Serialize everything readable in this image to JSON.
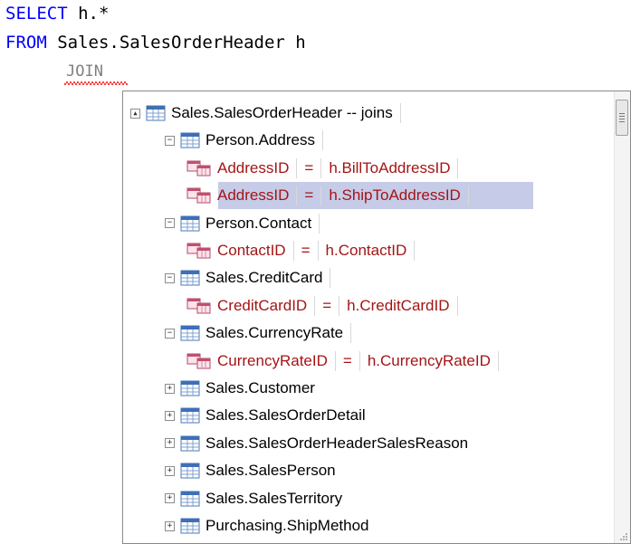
{
  "editor": {
    "line1": {
      "keyword": "SELECT",
      "rest": " h.*"
    },
    "line2": {
      "keyword": "FROM",
      "rest": " Sales.SalesOrderHeader h"
    },
    "line3": {
      "text": "JOIN"
    }
  },
  "popup": {
    "root": "Sales.SalesOrderHeader -- joins",
    "items": [
      {
        "table": "Person.Address",
        "expanded": true
      },
      {
        "left": "AddressID",
        "op": "=",
        "right": "h.BillToAddressID"
      },
      {
        "left": "AddressID",
        "op": "=",
        "right": "h.ShipToAddressID",
        "selected": true
      },
      {
        "table": "Person.Contact",
        "expanded": true
      },
      {
        "left": "ContactID",
        "op": "=",
        "right": "h.ContactID"
      },
      {
        "table": "Sales.CreditCard",
        "expanded": true
      },
      {
        "left": "CreditCardID",
        "op": "=",
        "right": "h.CreditCardID"
      },
      {
        "table": "Sales.CurrencyRate",
        "expanded": true
      },
      {
        "left": "CurrencyRateID",
        "op": "=",
        "right": "h.CurrencyRateID"
      },
      {
        "table": "Sales.Customer",
        "expanded": false
      },
      {
        "table": "Sales.SalesOrderDetail",
        "expanded": false
      },
      {
        "table": "Sales.SalesOrderHeaderSalesReason",
        "expanded": false
      },
      {
        "table": "Sales.SalesPerson",
        "expanded": false
      },
      {
        "table": "Sales.SalesTerritory",
        "expanded": false
      },
      {
        "table": "Purchasing.ShipMethod",
        "expanded": false
      }
    ],
    "expand_glyph_open": "−",
    "expand_glyph_closed": "+",
    "root_glyph": "▲"
  },
  "colors": {
    "keyword": "#0000ff",
    "column": "#a31515",
    "selection": "#c6cbe8"
  }
}
